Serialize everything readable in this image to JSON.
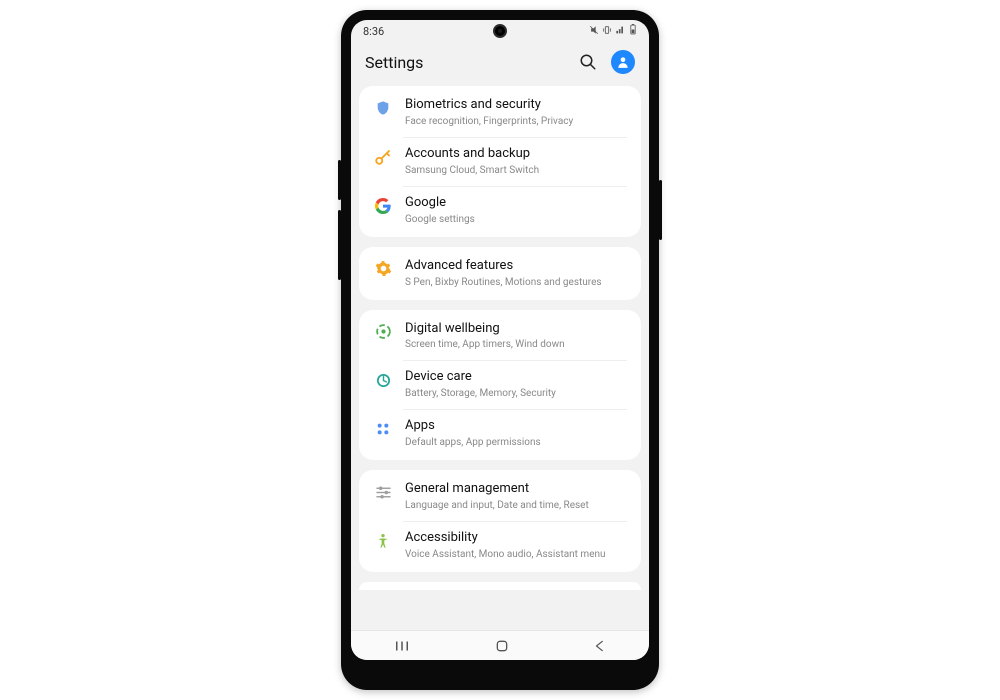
{
  "status": {
    "time": "8:36"
  },
  "header": {
    "title": "Settings"
  },
  "groups": [
    {
      "items": [
        {
          "icon": "shield",
          "title": "Biometrics and security",
          "sub": "Face recognition, Fingerprints, Privacy"
        },
        {
          "icon": "key",
          "title": "Accounts and backup",
          "sub": "Samsung Cloud, Smart Switch"
        },
        {
          "icon": "google",
          "title": "Google",
          "sub": "Google settings"
        }
      ]
    },
    {
      "items": [
        {
          "icon": "gear",
          "title": "Advanced features",
          "sub": "S Pen, Bixby Routines, Motions and gestures"
        }
      ]
    },
    {
      "items": [
        {
          "icon": "wellbeing",
          "title": "Digital wellbeing",
          "sub": "Screen time, App timers, Wind down"
        },
        {
          "icon": "care",
          "title": "Device care",
          "sub": "Battery, Storage, Memory, Security"
        },
        {
          "icon": "apps",
          "title": "Apps",
          "sub": "Default apps, App permissions"
        }
      ]
    },
    {
      "items": [
        {
          "icon": "sliders",
          "title": "General management",
          "sub": "Language and input, Date and time, Reset"
        },
        {
          "icon": "a11y",
          "title": "Accessibility",
          "sub": "Voice Assistant, Mono audio, Assistant menu"
        }
      ]
    }
  ]
}
